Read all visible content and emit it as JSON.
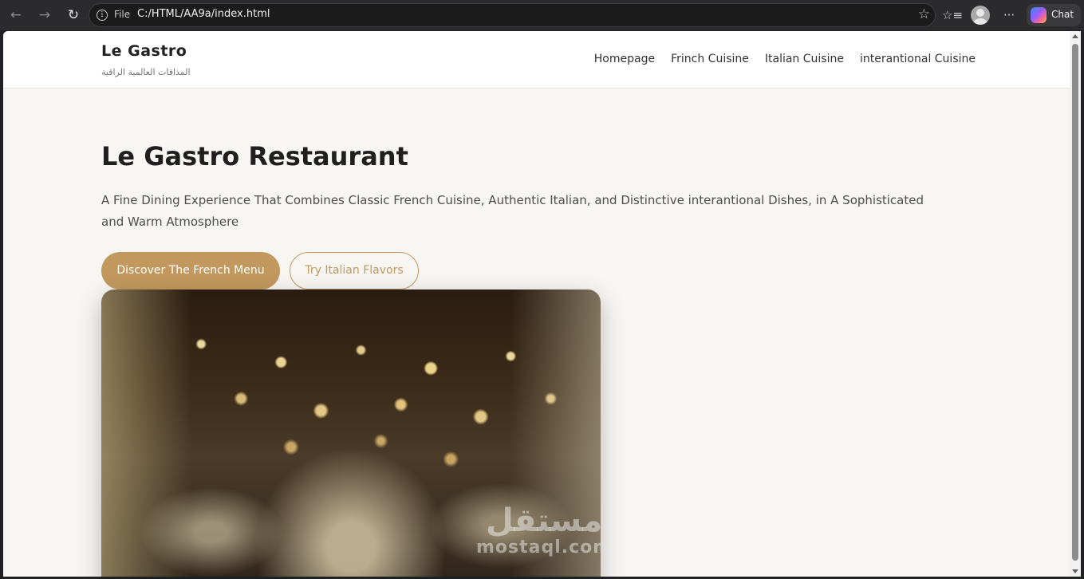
{
  "browser": {
    "back_icon": "←",
    "forward_icon": "→",
    "reload_icon": "↻",
    "info_icon": "i",
    "file_label": "File",
    "url": "C:/HTML/AA9a/index.html",
    "favorite_icon": "☆",
    "favorites_icon": "☆≡",
    "more_icon": "···",
    "chat_label": "Chat"
  },
  "site": {
    "brand": "Le Gastro",
    "tagline": "المذاقات العالمية الراقية",
    "nav": [
      {
        "label": "Homepage"
      },
      {
        "label": "Frinch Cuisine"
      },
      {
        "label": "Italian Cuisine"
      },
      {
        "label": "interantional Cuisine"
      }
    ]
  },
  "hero": {
    "title": "Le Gastro Restaurant",
    "description": "A Fine Dining Experience That Combines Classic French Cuisine, Authentic Italian, and Distinctive interantional Dishes, in A Sophisticated and Warm Atmosphere",
    "primary_button": "Discover The French Menu",
    "secondary_button": "Try Italian Flavors"
  },
  "watermark": {
    "arabic": "مستقل",
    "latin": "mostaql.com"
  },
  "colors": {
    "accent": "#c2985e",
    "page_background": "#f8f6f2"
  }
}
